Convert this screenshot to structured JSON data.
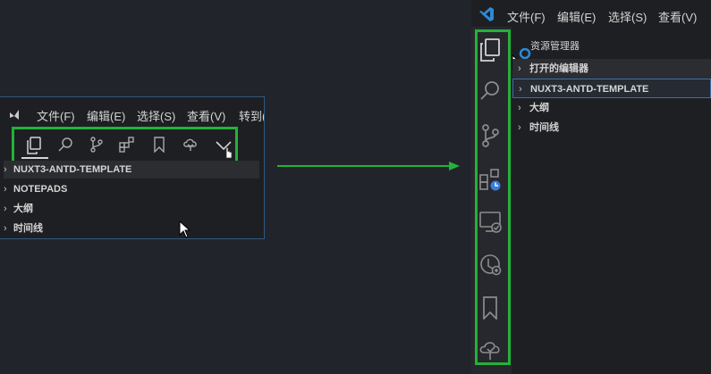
{
  "colors": {
    "highlight_border": "#22b23a",
    "arrow": "#22b23a",
    "vscode_blue": "#2c8ad8",
    "background": "#21252b"
  },
  "before": {
    "menu": [
      "文件(F)",
      "编辑(E)",
      "选择(S)",
      "查看(V)",
      "转到("
    ],
    "activity_icons": [
      "explorer-icon",
      "search-icon",
      "source-control-icon",
      "extensions-icon",
      "bookmark-icon",
      "cloud-icon",
      "more-chevron-icon"
    ],
    "sections": [
      "NUXT3-ANTD-TEMPLATE",
      "NOTEPADS",
      "大纲",
      "时间线"
    ]
  },
  "after": {
    "menu": [
      "文件(F)",
      "编辑(E)",
      "选择(S)",
      "查看(V)"
    ],
    "explorer_title": "资源管理器",
    "activity_icons": [
      "explorer-icon",
      "search-icon",
      "source-control-icon",
      "remote-explorer-icon",
      "monitor-icon",
      "timeline-icon",
      "bookmark-icon",
      "cloud-icon"
    ],
    "sections": [
      "打开的编辑器",
      "NUXT3-ANTD-TEMPLATE",
      "大纲",
      "时间线"
    ]
  }
}
